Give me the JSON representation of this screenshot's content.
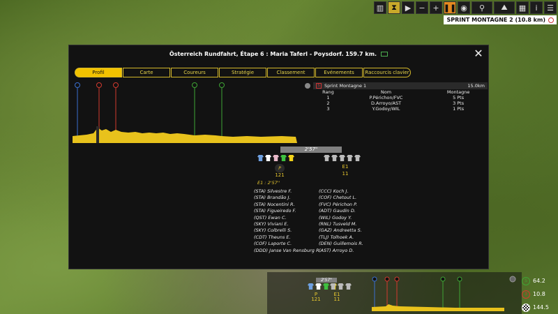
{
  "toolbar": {
    "items": [
      {
        "icon": "leaderboard-icon"
      },
      {
        "icon": "hourglass-icon"
      },
      {
        "icon": "play-icon"
      },
      {
        "icon": "minus-icon"
      },
      {
        "icon": "plus-icon"
      },
      {
        "icon": "pause-icon"
      },
      {
        "icon": "eye-icon"
      },
      {
        "icon": "cyclist-icon"
      },
      {
        "icon": "mountain-icon"
      },
      {
        "icon": "calculator-icon"
      },
      {
        "icon": "info-icon"
      },
      {
        "icon": "menu-icon"
      }
    ]
  },
  "sprint_tag": {
    "label": "SPRINT MONTAGNE 2 (10.8 km)"
  },
  "panel": {
    "title": "Österreich Rundfahrt, Étape 6 : Maria Taferl - Poysdorf. 159.7 km.",
    "close": "✕"
  },
  "tabs": [
    {
      "label": "Profil"
    },
    {
      "label": "Carte"
    },
    {
      "label": "Coureurs"
    },
    {
      "label": "Stratégie"
    },
    {
      "label": "Classement"
    },
    {
      "label": "Evénements"
    },
    {
      "label": "Raccourcis clavier"
    }
  ],
  "sprint": {
    "icon_letter": "S",
    "name": "Sprint Montagne 1",
    "distance": "15.0km",
    "headers": [
      "Rang",
      "Nom",
      "Montagne"
    ],
    "rows": [
      [
        "1",
        "P.Périchon/FVC",
        "5 Pts"
      ],
      [
        "2",
        "D.Arroyo/AST",
        "3 Pts"
      ],
      [
        "3",
        "Y.Godoy/WIL",
        "1 Pts"
      ]
    ]
  },
  "race": {
    "gap_bar": "2'57\"",
    "peloton_label": "P",
    "peloton_count": "121",
    "escape_label": "E1",
    "escape_count": "11",
    "gap_line": "E1 : 2'57''"
  },
  "riders_left": [
    "(STA) Silvestre F.",
    "(STA) Brandão J.",
    "(STA) Nocentini R.",
    "(STA) Figueiredo F.",
    "(QST) Ewan C.",
    "(SKY) Viviani E.",
    "(SKY) Colbrelli S.",
    "(CDT) Theuns E.",
    "(COF) Laporte C.",
    "(DDD) Janse Van Rensburg R."
  ],
  "riders_right": [
    "(CCC) Koch J.",
    "(COF) Chetout L.",
    "(FVC) Périchon P.",
    "(ADT) Gaudin D.",
    "(WIL) Godoy Y.",
    "(RNL) Tusveld M.",
    "(GAZ) Andreetta S.",
    "(TLJ) Tolhoek A.",
    "(DEN) Guillemois R.",
    "(AST) Arroyo D."
  ],
  "mini": {
    "gap": "2'57\"",
    "peloton_label": "P",
    "peloton_count": "121",
    "escape_label": "E1",
    "escape_count": "11"
  },
  "stats": [
    {
      "icon": "sprint-icon",
      "value": "64.2"
    },
    {
      "icon": "mountain-icon",
      "value": "10.8"
    },
    {
      "icon": "finish-flag-icon",
      "value": "144.5"
    }
  ],
  "colors": {
    "accent": "#f2c200",
    "profile": "#e8c21c",
    "sprint_green": "#3fa535",
    "mountain_red": "#d23a2f",
    "start_blue": "#3a6fd0"
  }
}
